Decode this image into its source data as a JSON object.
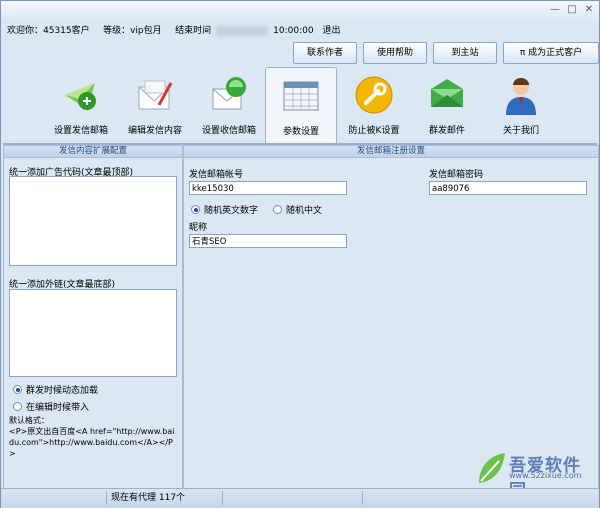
{
  "window": {
    "controls": [
      "—",
      "□",
      "✕"
    ]
  },
  "info": {
    "welcome": "欢迎你：45315客户",
    "level": "等级：vip包月",
    "end_label": "结束时间",
    "end_date": "2016-05-24",
    "end_time": "10:00:00",
    "logout": "退出"
  },
  "top_buttons": [
    {
      "label": "联系作者"
    },
    {
      "label": "使用帮助"
    },
    {
      "label": "到主站"
    },
    {
      "label": "π 成为正式客户"
    }
  ],
  "toolbar": [
    {
      "label": "设置发信邮箱",
      "icon": "send-mail-icon"
    },
    {
      "label": "编辑发信内容",
      "icon": "edit-letter-icon"
    },
    {
      "label": "设置收信邮箱",
      "icon": "receive-mail-icon"
    },
    {
      "label": "参数设置",
      "icon": "calendar-settings-icon"
    },
    {
      "label": "防止被K设置",
      "icon": "wrench-icon"
    },
    {
      "label": "群发邮件",
      "icon": "green-envelope-icon"
    },
    {
      "label": "关于我们",
      "icon": "user-avatar-icon"
    }
  ],
  "left_panel": {
    "title": "发信内容扩展配置",
    "ad_code_label": "统一添加广告代码(文章最顶部)",
    "outlink_label": "统一添加外链(文章最底部)",
    "radio_dynamic": "群发时候动态加载",
    "radio_edit": "在编辑时候带入",
    "format_title": "默认格式：",
    "format_body": "<P>原文出自百度<A href=\"http://www.baidu.com\">http://www.baidu.com</A></P>"
  },
  "right_panel": {
    "title": "发信邮箱注册设置",
    "account_label": "发信邮箱帐号",
    "account_value": "kke15030",
    "password_label": "发信邮箱密码",
    "password_value": "aa89076",
    "radio_random_en": "随机英文数字",
    "radio_random_cn": "随机中文",
    "nickname_label": "昵称",
    "nickname_value": "石青SEO"
  },
  "status": {
    "proxy": "现在有代理 117个"
  },
  "watermark": {
    "brand": "吾爱软件园",
    "url": "www.52zixue.com"
  }
}
